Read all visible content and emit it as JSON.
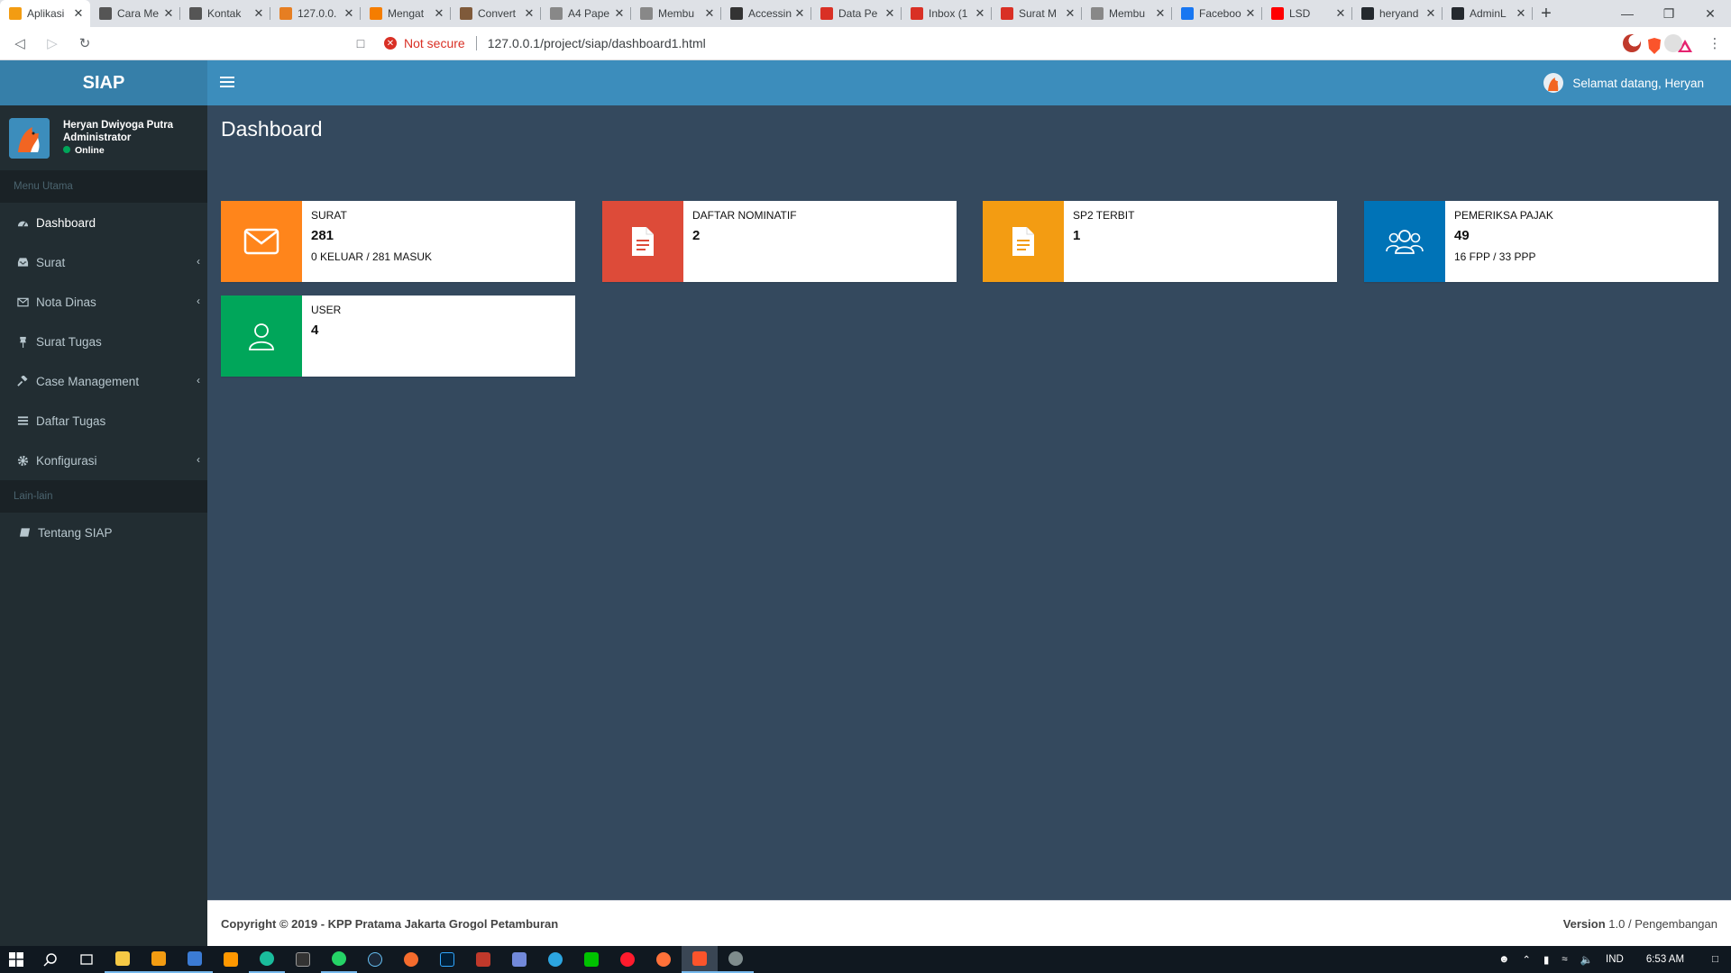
{
  "browser": {
    "tabs": [
      {
        "title": "Aplikasi",
        "icon": "app-favicon",
        "color": "#f39c12",
        "active": true
      },
      {
        "title": "Cara Me",
        "icon": "person-favicon",
        "color": "#555555"
      },
      {
        "title": "Kontak",
        "icon": "person-favicon",
        "color": "#555555"
      },
      {
        "title": "127.0.0.",
        "icon": "chart-favicon",
        "color": "#e67e22"
      },
      {
        "title": "Mengat",
        "icon": "blogger-favicon",
        "color": "#f57d00"
      },
      {
        "title": "Convert",
        "icon": "tool-favicon",
        "color": "#7f5a3a"
      },
      {
        "title": "A4 Pape",
        "icon": "doc-favicon",
        "color": "#888888"
      },
      {
        "title": "Membu",
        "icon": "doc-favicon",
        "color": "#888888"
      },
      {
        "title": "Accessin",
        "icon": "book-favicon",
        "color": "#333333"
      },
      {
        "title": "Data Pe",
        "icon": "gmail-favicon",
        "color": "#d93025"
      },
      {
        "title": "Inbox (1",
        "icon": "gmail-favicon",
        "color": "#d93025"
      },
      {
        "title": "Surat M",
        "icon": "gmail-favicon",
        "color": "#d93025"
      },
      {
        "title": "Membu",
        "icon": "doc-favicon",
        "color": "#888888"
      },
      {
        "title": "Faceboo",
        "icon": "facebook-favicon",
        "color": "#1877f2"
      },
      {
        "title": "LSD",
        "icon": "youtube-favicon",
        "color": "#ff0000"
      },
      {
        "title": "heryand",
        "icon": "github-favicon",
        "color": "#24292e"
      },
      {
        "title": "AdminL",
        "icon": "github-favicon",
        "color": "#24292e"
      }
    ],
    "new_tab": "+",
    "url_prefix_warning": "Not secure",
    "url": "127.0.0.1/project/siap/dashboard1.html"
  },
  "app": {
    "logo": "SIAP",
    "user": {
      "name": "Heryan Dwiyoga Putra",
      "role": "Administrator",
      "status": "Online"
    },
    "welcome": "Selamat datang, Heryan",
    "menu_header_main": "Menu Utama",
    "menu": [
      {
        "label": "Dashboard",
        "icon": "dashboard-icon",
        "chevron": false
      },
      {
        "label": "Surat",
        "icon": "inbox-icon",
        "chevron": true
      },
      {
        "label": "Nota Dinas",
        "icon": "envelope-icon",
        "chevron": true
      },
      {
        "label": "Surat Tugas",
        "icon": "pin-icon",
        "chevron": false
      },
      {
        "label": "Case Management",
        "icon": "gavel-icon",
        "chevron": true
      },
      {
        "label": "Daftar Tugas",
        "icon": "tasks-icon",
        "chevron": false
      },
      {
        "label": "Konfigurasi",
        "icon": "gear-icon",
        "chevron": true
      }
    ],
    "menu_header_other": "Lain-lain",
    "menu_other": [
      {
        "label": "Tentang SIAP",
        "icon": "book-icon"
      }
    ],
    "page_title": "Dashboard",
    "boxes": [
      {
        "label": "SURAT",
        "number": "281",
        "sub": "0 KELUAR / 281 MASUK",
        "color": "#ff851b",
        "icon": "envelope-icon"
      },
      {
        "label": "DAFTAR NOMINATIF",
        "number": "2",
        "sub": "",
        "color": "#dd4b39",
        "icon": "document-icon"
      },
      {
        "label": "SP2 TERBIT",
        "number": "1",
        "sub": "",
        "color": "#f39c12",
        "icon": "document-icon"
      },
      {
        "label": "PEMERIKSA PAJAK",
        "number": "49",
        "sub": "16 FPP / 33 PPP",
        "color": "#0073b7",
        "icon": "group-icon"
      },
      {
        "label": "USER",
        "number": "4",
        "sub": "",
        "color": "#00a65a",
        "icon": "user-icon"
      }
    ],
    "footer": {
      "copyright": "Copyright © 2019 - KPP Pratama Jakarta Grogol Petamburan",
      "version_label": "Version",
      "version_value": "1.0 / Pengembangan"
    }
  },
  "taskbar": {
    "language": "IND",
    "time": "6:53 AM"
  }
}
